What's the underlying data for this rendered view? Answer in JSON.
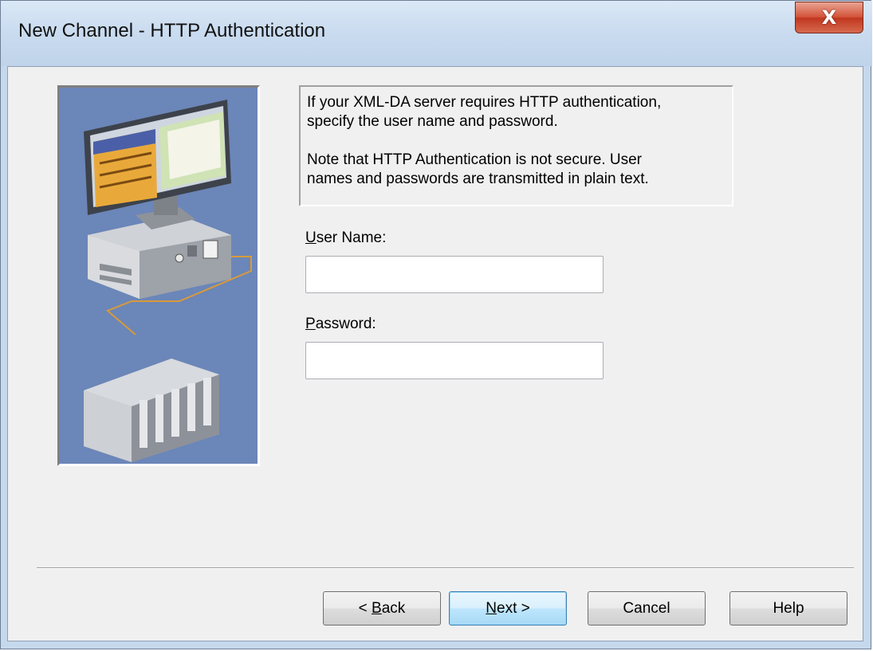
{
  "window": {
    "title": "New Channel - HTTP Authentication",
    "close_label": "X"
  },
  "info": {
    "paragraph1": "If your XML-DA server requires HTTP authentication,\nspecify the user name and password.",
    "paragraph2": "Note that HTTP Authentication is not secure. User\nnames and passwords are transmitted in plain text."
  },
  "form": {
    "username": {
      "label_mnemonic": "U",
      "label_rest": "ser Name:",
      "value": ""
    },
    "password": {
      "label_mnemonic": "P",
      "label_rest": "assword:",
      "value": ""
    }
  },
  "buttons": {
    "back": {
      "prefix": "< ",
      "mnemonic": "B",
      "rest": "ack"
    },
    "next": {
      "mnemonic": "N",
      "rest": "ext >"
    },
    "cancel": "Cancel",
    "help": "Help"
  },
  "illustration": {
    "icon": "computer-plc-network-illustration"
  }
}
